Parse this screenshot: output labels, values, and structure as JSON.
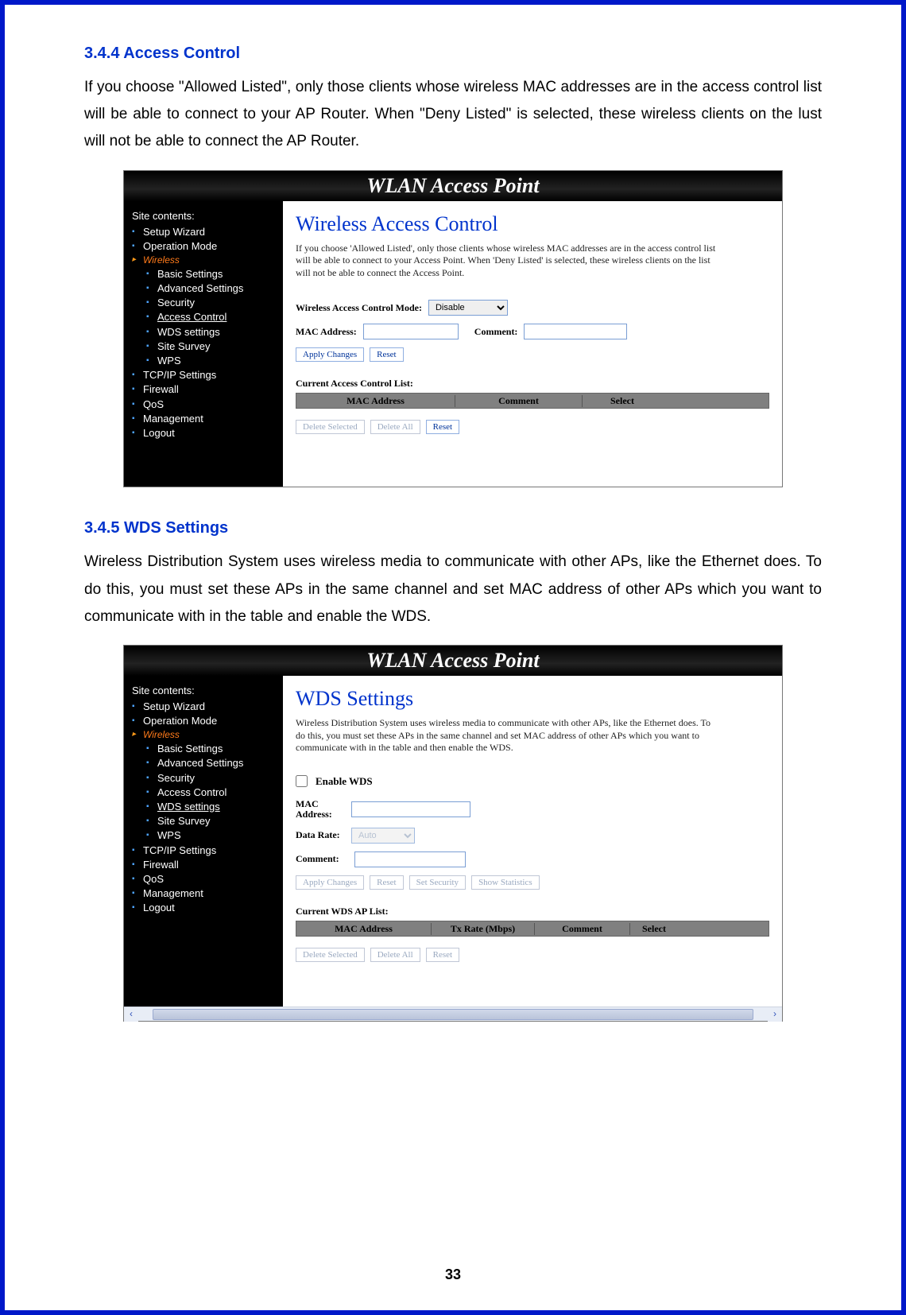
{
  "page_number": "33",
  "section1": {
    "heading": "3.4.4    Access Control",
    "body": "If you choose \"Allowed Listed\", only those clients whose wireless MAC addresses are in the access control list will be able to connect to your AP Router. When \"Deny Listed\" is selected, these wireless clients on the lust will not be able to connect the AP Router."
  },
  "section2": {
    "heading": "3.4.5    WDS Settings",
    "body": "Wireless Distribution System uses wireless media to communicate with other APs, like the Ethernet does. To do this, you must set these APs in the same channel and set MAC address of other APs which you want to communicate with in the table and enable the WDS."
  },
  "router_header": "WLAN Access Point",
  "sidebar": {
    "title": "Site contents:",
    "items_top": [
      "Setup Wizard",
      "Operation Mode"
    ],
    "wireless_folder": "Wireless",
    "items_wireless": [
      "Basic Settings",
      "Advanced Settings",
      "Security",
      "Access Control",
      "WDS settings",
      "Site Survey",
      "WPS"
    ],
    "items_bottom": [
      "TCP/IP Settings",
      "Firewall",
      "QoS",
      "Management",
      "Logout"
    ]
  },
  "panel_access": {
    "title": "Wireless Access Control",
    "desc": "If you choose 'Allowed Listed', only those clients whose wireless MAC addresses are in the access control list will be able to connect to your Access Point. When 'Deny Listed' is selected, these wireless clients on the list will not be able to connect the Access Point.",
    "mode_label": "Wireless Access Control Mode:",
    "mode_value": "Disable",
    "mac_label": "MAC Address:",
    "comment_label": "Comment:",
    "apply": "Apply Changes",
    "reset": "Reset",
    "list_title": "Current Access Control List:",
    "col_mac": "MAC Address",
    "col_comment": "Comment",
    "col_select": "Select",
    "delete_selected": "Delete Selected",
    "delete_all": "Delete All",
    "reset2": "Reset"
  },
  "panel_wds": {
    "title": "WDS Settings",
    "desc": "Wireless Distribution System uses wireless media to communicate with other APs, like the Ethernet does. To do this, you must set these APs in the same channel and set MAC address of other APs which you want to communicate with in the table and then enable the WDS.",
    "enable_label": "Enable WDS",
    "mac_label": "MAC Address:",
    "rate_label": "Data Rate:",
    "rate_value": "Auto",
    "comment_label": "Comment:",
    "apply": "Apply Changes",
    "reset": "Reset",
    "set_security": "Set Security",
    "show_stats": "Show Statistics",
    "list_title": "Current WDS AP List:",
    "col_mac": "MAC Address",
    "col_rate": "Tx Rate (Mbps)",
    "col_comment": "Comment",
    "col_select": "Select",
    "delete_selected": "Delete Selected",
    "delete_all": "Delete All",
    "reset2": "Reset"
  }
}
